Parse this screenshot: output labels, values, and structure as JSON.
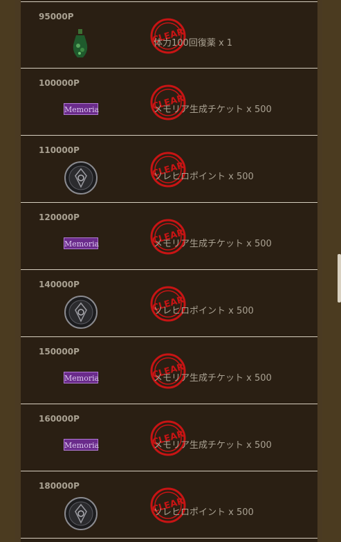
{
  "stamp_text": "CLEAR",
  "rows": [
    {
      "points": "95000P",
      "icon": "potion-icon",
      "reward": "体力100回復薬 x 1"
    },
    {
      "points": "100000P",
      "icon": "memoria-ticket-icon",
      "icon_label": "Memoria",
      "reward": "メモリア生成チケット x 500"
    },
    {
      "points": "110000P",
      "icon": "coin-icon",
      "reward": "ソレヒロポイント x 500"
    },
    {
      "points": "120000P",
      "icon": "memoria-ticket-icon",
      "icon_label": "Memoria",
      "reward": "メモリア生成チケット x 500"
    },
    {
      "points": "140000P",
      "icon": "coin-icon",
      "reward": "ソレヒロポイント x 500"
    },
    {
      "points": "150000P",
      "icon": "memoria-ticket-icon",
      "icon_label": "Memoria",
      "reward": "メモリア生成チケット x 500"
    },
    {
      "points": "160000P",
      "icon": "memoria-ticket-icon",
      "icon_label": "Memoria",
      "reward": "メモリア生成チケット x 500"
    },
    {
      "points": "180000P",
      "icon": "coin-icon",
      "reward": "ソレヒロポイント x 500"
    }
  ],
  "colors": {
    "clear_red": "#c81414",
    "memoria_purple": "#6a2b8b"
  }
}
